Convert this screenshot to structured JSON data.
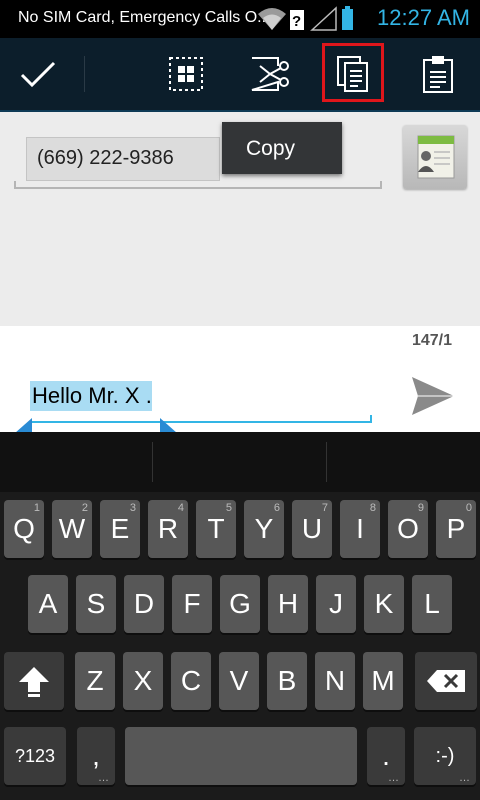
{
  "status": {
    "carrier": "No SIM Card, Emergency Calls O...",
    "time": "12:27 AM",
    "battery_color": "#33b5e5"
  },
  "actionbar": {
    "done": "done-checkmark",
    "select_all": "select-all-icon",
    "cut": "cut-icon",
    "copy": "copy-icon",
    "paste": "paste-icon"
  },
  "tooltip": {
    "label": "Copy"
  },
  "recipient": {
    "value": "(669) 222-9386"
  },
  "compose": {
    "counter": "147/1",
    "text": "Hello Mr. X ."
  },
  "keyboard": {
    "row1": [
      {
        "k": "Q",
        "h": "1"
      },
      {
        "k": "W",
        "h": "2"
      },
      {
        "k": "E",
        "h": "3"
      },
      {
        "k": "R",
        "h": "4"
      },
      {
        "k": "T",
        "h": "5"
      },
      {
        "k": "Y",
        "h": "6"
      },
      {
        "k": "U",
        "h": "7"
      },
      {
        "k": "I",
        "h": "8"
      },
      {
        "k": "O",
        "h": "9"
      },
      {
        "k": "P",
        "h": "0"
      }
    ],
    "row2": [
      "A",
      "S",
      "D",
      "F",
      "G",
      "H",
      "J",
      "K",
      "L"
    ],
    "row3": [
      "Z",
      "X",
      "C",
      "V",
      "B",
      "N",
      "M"
    ],
    "symbols_label": "?123",
    "comma": ",",
    "period": ".",
    "smiley": ":-)"
  }
}
